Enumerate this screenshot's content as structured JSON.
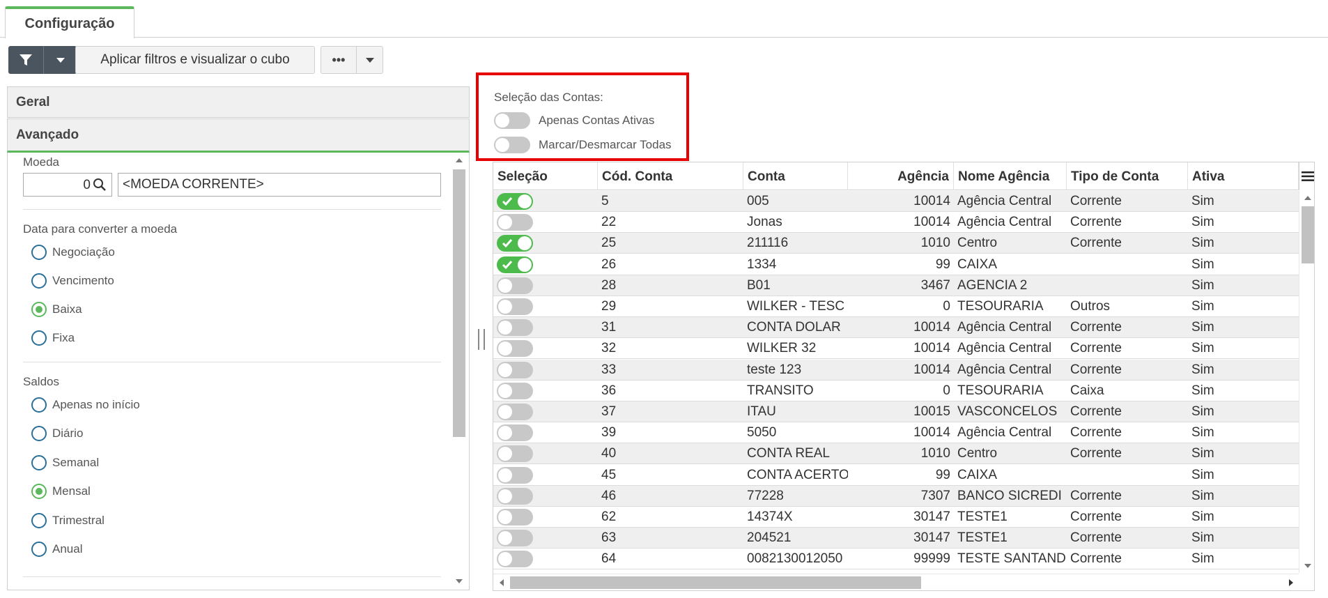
{
  "tabs": [
    {
      "label": "Configuração",
      "active": true
    }
  ],
  "toolbar": {
    "apply_label": "Aplicar filtros e visualizar o cubo",
    "more_label": "•••"
  },
  "left_panel": {
    "geral_label": "Geral",
    "avancado_label": "Avançado",
    "moeda": {
      "label": "Moeda",
      "code": "0",
      "name": "<MOEDA CORRENTE>"
    },
    "data_converter": {
      "label": "Data para converter a moeda",
      "options": [
        {
          "label": "Negociação",
          "selected": false
        },
        {
          "label": "Vencimento",
          "selected": false
        },
        {
          "label": "Baixa",
          "selected": true
        },
        {
          "label": "Fixa",
          "selected": false
        }
      ]
    },
    "saldos": {
      "label": "Saldos",
      "options": [
        {
          "label": "Apenas no início",
          "selected": false
        },
        {
          "label": "Diário",
          "selected": false
        },
        {
          "label": "Semanal",
          "selected": false
        },
        {
          "label": "Mensal",
          "selected": true
        },
        {
          "label": "Trimestral",
          "selected": false
        },
        {
          "label": "Anual",
          "selected": false
        }
      ]
    }
  },
  "selecao_contas": {
    "title": "Seleção das Contas:",
    "toggles": [
      {
        "label": "Apenas Contas Ativas",
        "on": false
      },
      {
        "label": "Marcar/Desmarcar Todas",
        "on": false
      }
    ]
  },
  "grid": {
    "columns": [
      "Seleção",
      "Cód. Conta",
      "Conta",
      "Agência",
      "Nome Agência",
      "Tipo de Conta",
      "Ativa"
    ],
    "rows": [
      {
        "sel": true,
        "cod": "5",
        "conta": "005",
        "agencia": "10014",
        "nome": "Agência Central",
        "tipo": "Corrente",
        "ativa": "Sim"
      },
      {
        "sel": false,
        "cod": "22",
        "conta": "Jonas",
        "agencia": "10014",
        "nome": "Agência Central",
        "tipo": "Corrente",
        "ativa": "Sim"
      },
      {
        "sel": true,
        "cod": "25",
        "conta": "211116",
        "agencia": "1010",
        "nome": "Centro",
        "tipo": "Corrente",
        "ativa": "Sim"
      },
      {
        "sel": true,
        "cod": "26",
        "conta": "1334",
        "agencia": "99",
        "nome": "CAIXA",
        "tipo": "",
        "ativa": "Sim"
      },
      {
        "sel": false,
        "cod": "28",
        "conta": "B01",
        "agencia": "3467",
        "nome": "AGENCIA 2",
        "tipo": "",
        "ativa": "Sim"
      },
      {
        "sel": false,
        "cod": "29",
        "conta": "WILKER - TESC",
        "agencia": "0",
        "nome": "TESOURARIA",
        "tipo": "Outros",
        "ativa": "Sim"
      },
      {
        "sel": false,
        "cod": "31",
        "conta": "CONTA DOLAR",
        "agencia": "10014",
        "nome": "Agência Central",
        "tipo": "Corrente",
        "ativa": "Sim"
      },
      {
        "sel": false,
        "cod": "32",
        "conta": "WILKER 32",
        "agencia": "10014",
        "nome": "Agência Central",
        "tipo": "Corrente",
        "ativa": "Sim"
      },
      {
        "sel": false,
        "cod": "33",
        "conta": "teste 123",
        "agencia": "10014",
        "nome": "Agência Central",
        "tipo": "Corrente",
        "ativa": "Sim"
      },
      {
        "sel": false,
        "cod": "36",
        "conta": "TRANSITO",
        "agencia": "0",
        "nome": "TESOURARIA",
        "tipo": "Caixa",
        "ativa": "Sim"
      },
      {
        "sel": false,
        "cod": "37",
        "conta": "ITAU",
        "agencia": "10015",
        "nome": "VASCONCELOS",
        "tipo": "Corrente",
        "ativa": "Sim"
      },
      {
        "sel": false,
        "cod": "39",
        "conta": "5050",
        "agencia": "10014",
        "nome": "Agência Central",
        "tipo": "Corrente",
        "ativa": "Sim"
      },
      {
        "sel": false,
        "cod": "40",
        "conta": "CONTA REAL",
        "agencia": "1010",
        "nome": "Centro",
        "tipo": "Corrente",
        "ativa": "Sim"
      },
      {
        "sel": false,
        "cod": "45",
        "conta": "CONTA ACERTO",
        "agencia": "99",
        "nome": "CAIXA",
        "tipo": "",
        "ativa": "Sim"
      },
      {
        "sel": false,
        "cod": "46",
        "conta": "77228",
        "agencia": "7307",
        "nome": "BANCO SICREDI",
        "tipo": "Corrente",
        "ativa": "Sim"
      },
      {
        "sel": false,
        "cod": "62",
        "conta": "14374X",
        "agencia": "30147",
        "nome": "TESTE1",
        "tipo": "Corrente",
        "ativa": "Sim"
      },
      {
        "sel": false,
        "cod": "63",
        "conta": "204521",
        "agencia": "30147",
        "nome": "TESTE1",
        "tipo": "Corrente",
        "ativa": "Sim"
      },
      {
        "sel": false,
        "cod": "64",
        "conta": "0082130012050",
        "agencia": "99999",
        "nome": "TESTE SANTANDER",
        "tipo": "Corrente",
        "ativa": "Sim"
      }
    ]
  },
  "colors": {
    "accent": "#5cb85c",
    "toggle_on": "#4cbb4c",
    "highlight": "#e60000",
    "dark_button": "#4a5560"
  }
}
